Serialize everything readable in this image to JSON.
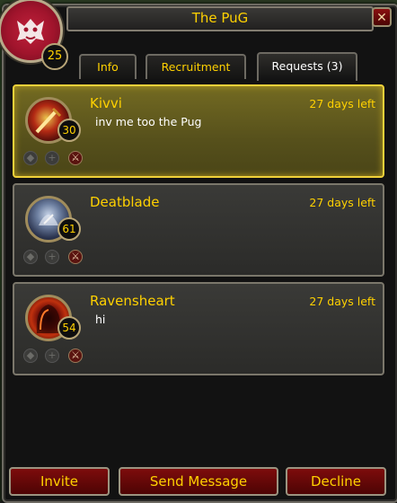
{
  "window": {
    "title": "The PuG",
    "close_label": "✕"
  },
  "group": {
    "level": "25"
  },
  "tabs": [
    {
      "label": "Info"
    },
    {
      "label": "Recruitment"
    },
    {
      "label": "Requests (3)"
    }
  ],
  "requests": [
    {
      "name": "Kivvi",
      "level": "30",
      "time_left": "27 days left",
      "message": "inv me too the Pug"
    },
    {
      "name": "Deatblade",
      "level": "61",
      "time_left": "27 days left",
      "message": ""
    },
    {
      "name": "Ravensheart",
      "level": "54",
      "time_left": "27 days left",
      "message": "hi"
    }
  ],
  "buttons": {
    "invite": "Invite",
    "send_message": "Send Message",
    "decline": "Decline"
  },
  "colors": {
    "gold": "#ffd100",
    "selected_border": "#f0d13a",
    "button_red": "#7d0c0c"
  }
}
